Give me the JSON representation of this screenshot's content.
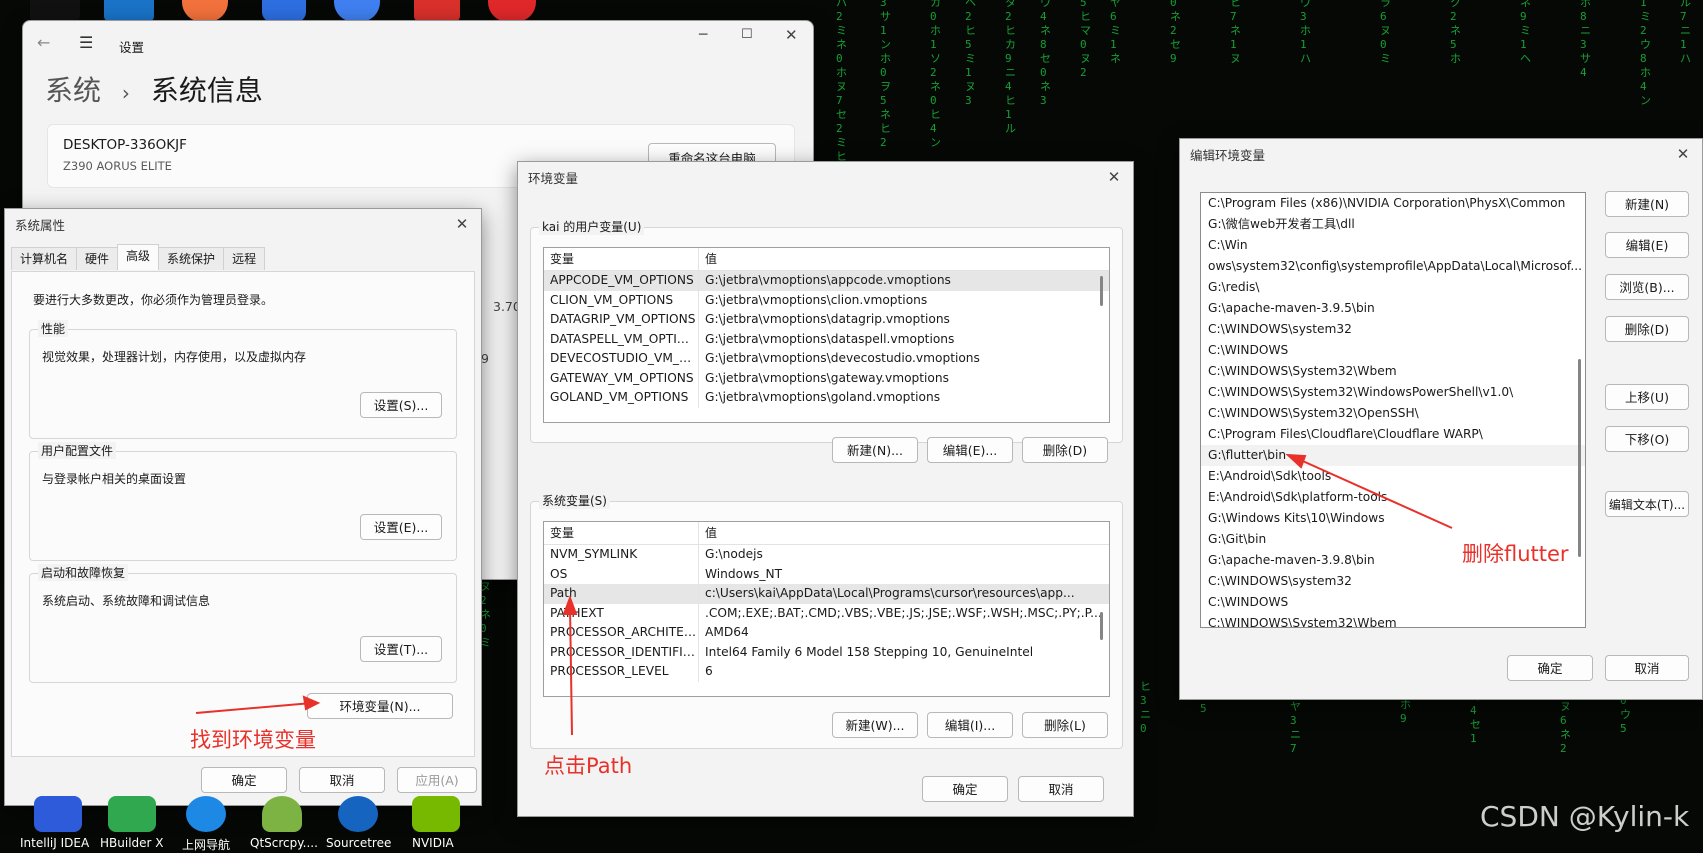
{
  "settings": {
    "breadcrumb_parent": "系统",
    "breadcrumb_sep": "›",
    "breadcrumb_current": "系统信息",
    "window_title": "设置",
    "device_name": "DESKTOP-336OKJF",
    "device_model": "Z390 AORUS ELITE",
    "rename_button": "重命名这台电脑",
    "peek_1": "3.70",
    "peek_2": "9"
  },
  "sys_props": {
    "title": "系统属性",
    "tabs": [
      {
        "label": "计算机名"
      },
      {
        "label": "硬件"
      },
      {
        "label": "高级",
        "active": true
      },
      {
        "label": "系统保护"
      },
      {
        "label": "远程"
      }
    ],
    "admin_note": "要进行大多数更改，你必须作为管理员登录。",
    "groups": [
      {
        "title": "性能",
        "desc": "视觉效果，处理器计划，内存使用，以及虚拟内存",
        "button": "设置(S)..."
      },
      {
        "title": "用户配置文件",
        "desc": "与登录帐户相关的桌面设置",
        "button": "设置(E)..."
      },
      {
        "title": "启动和故障恢复",
        "desc": "系统启动、系统故障和调试信息",
        "button": "设置(T)..."
      }
    ],
    "env_button": "环境变量(N)...",
    "ok": "确定",
    "cancel": "取消",
    "apply": "应用(A)"
  },
  "env_vars": {
    "title": "环境变量",
    "user_section": "kai 的用户变量(U)",
    "col_var": "变量",
    "col_val": "值",
    "user_rows": [
      {
        "name": "APPCODE_VM_OPTIONS",
        "value": "G:\\jetbra\\vmoptions\\appcode.vmoptions"
      },
      {
        "name": "CLION_VM_OPTIONS",
        "value": "G:\\jetbra\\vmoptions\\clion.vmoptions"
      },
      {
        "name": "DATAGRIP_VM_OPTIONS",
        "value": "G:\\jetbra\\vmoptions\\datagrip.vmoptions"
      },
      {
        "name": "DATASPELL_VM_OPTIONS",
        "value": "G:\\jetbra\\vmoptions\\dataspell.vmoptions"
      },
      {
        "name": "DEVECOSTUDIO_VM_OPT...",
        "value": "G:\\jetbra\\vmoptions\\devecostudio.vmoptions"
      },
      {
        "name": "GATEWAY_VM_OPTIONS",
        "value": "G:\\jetbra\\vmoptions\\gateway.vmoptions"
      },
      {
        "name": "GOLAND_VM_OPTIONS",
        "value": "G:\\jetbra\\vmoptions\\goland.vmoptions"
      }
    ],
    "user_buttons": {
      "new": "新建(N)...",
      "edit": "编辑(E)...",
      "delete": "删除(D)"
    },
    "system_section": "系统变量(S)",
    "system_rows": [
      {
        "name": "NVM_SYMLINK",
        "value": "G:\\nodejs"
      },
      {
        "name": "OS",
        "value": "Windows_NT"
      },
      {
        "name": "Path",
        "value": "c:\\Users\\kai\\AppData\\Local\\Programs\\cursor\\resources\\app..."
      },
      {
        "name": "PATHEXT",
        "value": ".COM;.EXE;.BAT;.CMD;.VBS;.VBE;.JS;.JSE;.WSF;.WSH;.MSC;.PY;.P..."
      },
      {
        "name": "PROCESSOR_ARCHITECT...",
        "value": "AMD64"
      },
      {
        "name": "PROCESSOR_IDENTIFIER",
        "value": "Intel64 Family 6 Model 158 Stepping 10, GenuineIntel"
      },
      {
        "name": "PROCESSOR_LEVEL",
        "value": "6"
      }
    ],
    "system_buttons": {
      "new": "新建(W)...",
      "edit": "编辑(I)...",
      "delete": "删除(L)"
    },
    "ok": "确定",
    "cancel": "取消"
  },
  "edit_env": {
    "title": "编辑环境变量",
    "paths": [
      "C:\\Program Files (x86)\\NVIDIA Corporation\\PhysX\\Common",
      "G:\\微信web开发者工具\\dll",
      "C:\\Win",
      "ows\\system32\\config\\systemprofile\\AppData\\Local\\Microsof...",
      "G:\\redis\\",
      "G:\\apache-maven-3.9.5\\bin",
      "C:\\WINDOWS\\system32",
      "C:\\WINDOWS",
      "C:\\WINDOWS\\System32\\Wbem",
      "C:\\WINDOWS\\System32\\WindowsPowerShell\\v1.0\\",
      "C:\\WINDOWS\\System32\\OpenSSH\\",
      "C:\\Program Files\\Cloudflare\\Cloudflare WARP\\",
      "G:\\flutter\\bin",
      "E:\\Android\\Sdk\\tools",
      "E:\\Android\\Sdk\\platform-tools",
      "G:\\Windows Kits\\10\\Windows",
      "G:\\Git\\bin",
      "G:\\apache-maven-3.9.8\\bin",
      "C:\\WINDOWS\\system32",
      "C:\\WINDOWS",
      "C:\\WINDOWS\\System32\\Wbem"
    ],
    "buttons": {
      "new": "新建(N)",
      "edit": "编辑(E)",
      "browse": "浏览(B)...",
      "delete": "删除(D)",
      "move_up": "上移(U)",
      "move_down": "下移(O)",
      "edit_text": "编辑文本(T)..."
    },
    "ok": "确定",
    "cancel": "取消"
  },
  "annotations": {
    "find_env": "找到环境变量",
    "click_path": "点击Path",
    "delete_flutter": "删除flutter",
    "color": "#e8312a"
  },
  "taskbar": {
    "items": [
      {
        "label": "IntelliJ IDEA",
        "icon": "intellij-icon",
        "color": "#2d5bd9"
      },
      {
        "label": "HBuilder X",
        "icon": "hbuilder-icon",
        "color": "#2fa84f"
      },
      {
        "label": "上网导航",
        "icon": "ie-icon",
        "color": "#1e88e5"
      },
      {
        "label": "QtScrcpy....",
        "icon": "android-icon",
        "color": "#7cb342"
      },
      {
        "label": "Sourcetree",
        "icon": "sourcetree-icon",
        "color": "#1565c0"
      },
      {
        "label": "NVIDIA",
        "icon": "nvidia-icon",
        "color": "#76b900"
      }
    ]
  },
  "watermark": "CSDN @Kylin-k"
}
